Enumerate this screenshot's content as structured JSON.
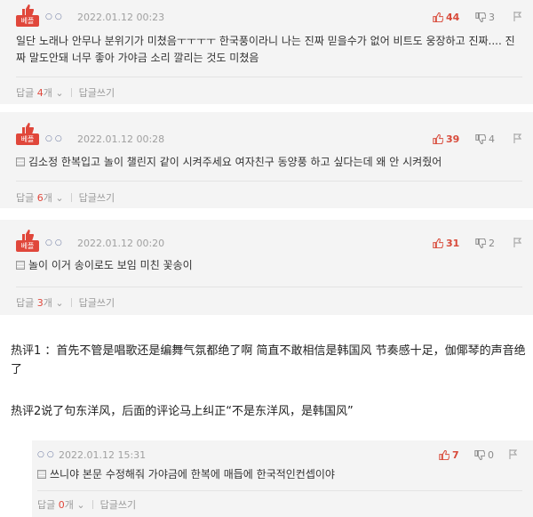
{
  "colors": {
    "accent": "#e0473b",
    "card_bg": "#f4f4f4",
    "dots": "#6d7aa2"
  },
  "comments": [
    {
      "badge": "베플",
      "dots": "○○",
      "time": "2022.01.12 00:23",
      "likes": "44",
      "dislikes": "3",
      "text": "일단 노래나 안무나 분위기가 미쳤음ㅜㅜㅜㅜ 한국풍이라니 나는 진짜 믿을수가 없어 비트도 웅장하고 진짜.... 진짜 말도안돼 너무 좋아 가야금 소리 깔리는 것도 미쳤음",
      "reply_label": "답글",
      "reply_count": "4",
      "reply_unit": "개",
      "write_reply": "답글쓰기"
    },
    {
      "badge": "베플",
      "dots": "○○",
      "time": "2022.01.12 00:28",
      "likes": "39",
      "dislikes": "4",
      "text": "김소정 한복입고 놀이 챌린지 같이 시켜주세요 여자친구 동양풍 하고 싶다는데 왜 안 시켜줬어",
      "reply_label": "답글",
      "reply_count": "6",
      "reply_unit": "개",
      "write_reply": "답글쓰기"
    },
    {
      "badge": "베플",
      "dots": "○○",
      "time": "2022.01.12 00:20",
      "likes": "31",
      "dislikes": "2",
      "text": "놀이 이거 송이로도 보임 미친 꽃송이",
      "reply_label": "답글",
      "reply_count": "3",
      "reply_unit": "개",
      "write_reply": "답글쓰기"
    }
  ],
  "article": {
    "para1": "热评1 ：首先不管是唱歌还是编舞气氛都绝了啊 简直不敢相信是韩国风 节奏感十足，伽倻琴的声音绝了",
    "para2": "热评2说了句东洋风，后面的评论马上纠正“不是东洋风，是韩国风”"
  },
  "reply": {
    "dots": "○○",
    "time": "2022.01.12 15:31",
    "likes": "7",
    "dislikes": "0",
    "text": "쓰니야 본문 수정해줘 가야금에 한복에 매듭에 한국적인컨셉이야",
    "reply_label": "답글",
    "reply_count": "0",
    "reply_unit": "개",
    "write_reply": "답글쓰기"
  }
}
